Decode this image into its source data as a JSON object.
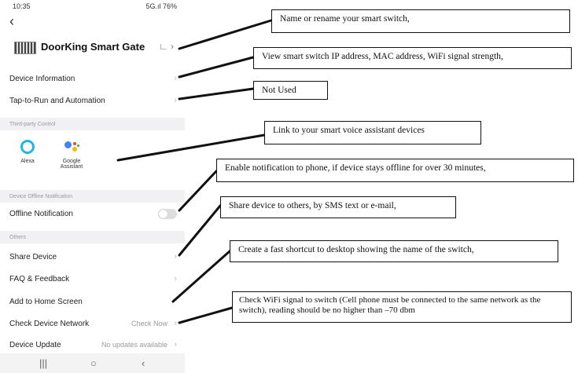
{
  "status_bar": {
    "time": "10:35",
    "right": "5G.ıl 76%"
  },
  "device": {
    "name": "DoorKing Smart Gate"
  },
  "rows": {
    "device_information": "Device Information",
    "tap_to_run": "Tap-to-Run and Automation",
    "offline_notification": "Offline Notification",
    "share_device": "Share Device",
    "faq": "FAQ & Feedback",
    "add_home": "Add to Home Screen",
    "check_network": "Check Device Network",
    "check_now": "Check Now",
    "device_update": "Device Update",
    "no_updates": "No updates available"
  },
  "sections": {
    "third_party": "Third-party Control",
    "offline": "Device Offline Notification",
    "others": "Others"
  },
  "assistants": {
    "alexa": "Alexa",
    "google": "Google Assistant"
  },
  "callouts": {
    "rename": "Name or rename your smart switch,",
    "info": "View smart switch IP address, MAC address, WiFi signal strength,",
    "not_used": "Not Used",
    "voice": "Link to your smart voice assistant devices",
    "offline": "Enable notification to phone, if device stays offline for over 30 minutes,",
    "share": "Share device to others, by SMS text or e-mail,",
    "shortcut": "Create a fast shortcut to desktop showing the name of the switch,",
    "network": "Check WiFi signal to switch (Cell phone must be connected to the same network as the switch), reading should be no higher than –70 dbm"
  },
  "icons": [
    "back-arrow",
    "edit-pencil",
    "chevron-right",
    "alexa",
    "google-assistant",
    "toggle",
    "nav-recents",
    "nav-home",
    "nav-back"
  ],
  "colors": {
    "alexa": "#21b6e6",
    "google_blue": "#4285f4",
    "google_red": "#ea4335",
    "google_yellow": "#fbbc05",
    "google_green": "#34a853"
  }
}
